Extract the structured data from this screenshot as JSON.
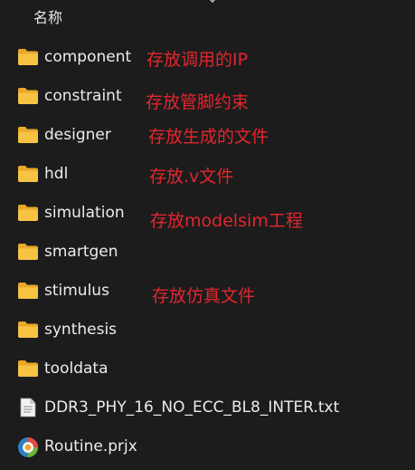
{
  "header": {
    "name_column": "名称"
  },
  "files": [
    {
      "name": "component",
      "type": "folder",
      "note": "存放调用的IP"
    },
    {
      "name": "constraint",
      "type": "folder",
      "note": "存放管脚约束"
    },
    {
      "name": "designer",
      "type": "folder",
      "note": "存放生成的文件"
    },
    {
      "name": "hdl",
      "type": "folder",
      "note": "存放.v文件"
    },
    {
      "name": "simulation",
      "type": "folder",
      "note": "存放modelsim工程"
    },
    {
      "name": "smartgen",
      "type": "folder",
      "note": ""
    },
    {
      "name": "stimulus",
      "type": "folder",
      "note": "存放仿真文件"
    },
    {
      "name": "synthesis",
      "type": "folder",
      "note": ""
    },
    {
      "name": "tooldata",
      "type": "folder",
      "note": ""
    },
    {
      "name": "DDR3_PHY_16_NO_ECC_BL8_INTER.txt",
      "type": "text-file",
      "note": ""
    },
    {
      "name": "Routine.prjx",
      "type": "project-file",
      "note": ""
    }
  ],
  "colors": {
    "background": "#1c1c1c",
    "text": "#ececec",
    "annotation": "#e3262e",
    "folder": "#f6c343"
  }
}
